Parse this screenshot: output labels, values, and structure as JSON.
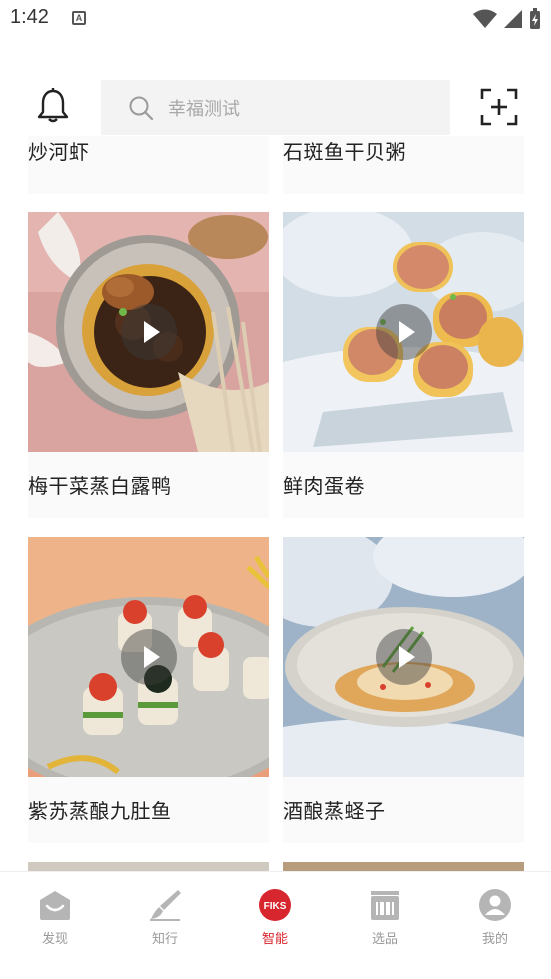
{
  "status_bar": {
    "time": "1:42"
  },
  "header": {
    "search_placeholder": "幸福测试"
  },
  "feed": {
    "partial_top": [
      {
        "title": "炒河虾"
      },
      {
        "title": "石斑鱼干贝粥"
      }
    ],
    "cards": [
      {
        "title": "梅干菜蒸白露鸭",
        "has_video": true
      },
      {
        "title": "鲜肉蛋卷",
        "has_video": true
      },
      {
        "title": "紫苏蒸酿九肚鱼",
        "has_video": true
      },
      {
        "title": "酒酿蒸蛏子",
        "has_video": true
      }
    ]
  },
  "bottom_nav": {
    "items": [
      {
        "label": "发现",
        "icon": "discover-icon"
      },
      {
        "label": "知行",
        "icon": "brush-icon"
      },
      {
        "label": "智能",
        "icon": "fiks-logo-icon",
        "badge": "FIKS",
        "active": true
      },
      {
        "label": "选品",
        "icon": "stove-icon"
      },
      {
        "label": "我的",
        "icon": "profile-icon"
      }
    ]
  },
  "colors": {
    "accent": "#d7262e",
    "nav_inactive": "#999999",
    "search_bg": "#f3f3f3"
  }
}
